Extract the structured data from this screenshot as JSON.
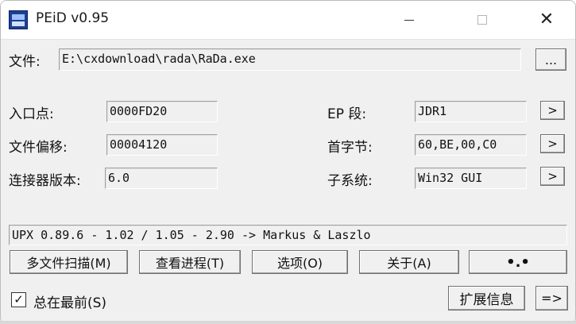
{
  "window": {
    "title": "PEiD v0.95",
    "icon": "peid-app-icon",
    "controls": {
      "minimize": "minimize-icon",
      "maximize": "maximize-icon",
      "close": "close-icon"
    }
  },
  "file": {
    "label": "文件:",
    "path": "E:\\cxdownload\\rada\\RaDa.exe",
    "browse_label": "..."
  },
  "info": {
    "entry_point_label": "入口点:",
    "entry_point_value": "0000FD20",
    "file_offset_label": "文件偏移:",
    "file_offset_value": "00004120",
    "linker_version_label": "连接器版本:",
    "linker_version_value": "6.0",
    "ep_section_label": "EP 段:",
    "ep_section_value": "JDR1",
    "first_bytes_label": "首字节:",
    "first_bytes_value": "60,BE,00,C0",
    "subsystem_label": "子系统:",
    "subsystem_value": "Win32 GUI",
    "arrow_label": ">"
  },
  "result": {
    "text": "UPX 0.89.6 - 1.02 / 1.05 - 2.90 -> Markus & Laszlo"
  },
  "buttons": {
    "multi_scan": "多文件扫描(M)",
    "task_viewer": "查看进程(T)",
    "options": "选项(O)",
    "about": "关于(A)",
    "exit_glyph": "•.•"
  },
  "footer": {
    "stay_on_top_label": "总在最前(S)",
    "stay_on_top_checked": true,
    "check_mark": "✓",
    "plugins_label": "扩展信息",
    "next_label": "=>"
  }
}
